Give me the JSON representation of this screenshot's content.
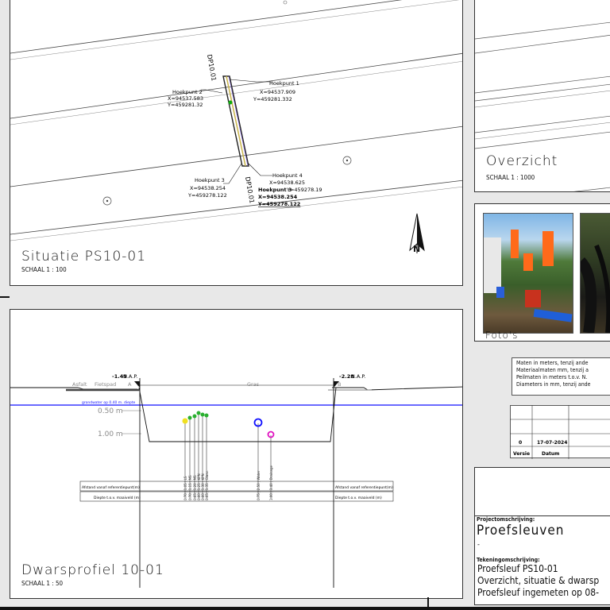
{
  "situatie": {
    "title": "Situatie PS10-01",
    "scale": "SCHAAL 1 : 100",
    "dp_top": "DP10.01",
    "dp_bottom": "DP10.01",
    "hoekpunt1": {
      "label": "Hoekpunt 1",
      "x": "X=94537.909",
      "y": "Y=459281.332"
    },
    "hoekpunt2": {
      "label": "Hoekpunt 2",
      "x": "X=94537.583",
      "y": "Y=459281.32"
    },
    "hoekpunt3": {
      "label": "Hoekpunt 3",
      "x": "X=94538.254",
      "y": "Y=459278.122"
    },
    "hoekpunt4": {
      "label": "Hoekpunt 4",
      "x": "X=94538.625",
      "y": "Y=459278.19"
    },
    "overlap": {
      "label": "Hoekpunt 3",
      "x": "X=94538.254",
      "y": "Y=459278.122"
    }
  },
  "overzicht": {
    "title": "Overzicht",
    "scale": "SCHAAL 1 : 1000"
  },
  "fotos": {
    "title": "Foto's"
  },
  "notes": [
    "Maten in meters, tenzij ande",
    "Materiaalmaten mm, tenzij a",
    "Peilmaten in meters t.o.v. N.",
    "Diameters in mm, tenzij ande"
  ],
  "revisions": {
    "row": {
      "versie": "0",
      "datum": "17-07-2024"
    },
    "headers": {
      "versie": "Versie",
      "datum": "Datum"
    }
  },
  "dwarsprofiel": {
    "title": "Dwarsprofiel 10-01",
    "scale": "SCHAAL 1 : 50",
    "level_a": "-1.49",
    "level_b": "-2.28",
    "nap": "N.A.P.",
    "asfalt": "Asfalt",
    "fietspad": "Fietspad",
    "point_a": "A",
    "point_b": "B",
    "gras": "Gras",
    "grondwater": "grondwater op 0.40 m. diepte",
    "depth1": "0.50 m",
    "depth2": "1.00 m",
    "row_afstand": "Afstand vanaf referentiepunt(m)",
    "row_diepte": "Diepte t.o.v. maaiveld (m)",
    "cables": [
      "0.70 | 1.05 | LS",
      "0.70 | 1.15 | MS",
      "0.65 | 1.20 | MS",
      "0.60 | 1.25 | KPN",
      "0.60 | 1.30 | KPN",
      "0.65 | 1.35 | Glasv."
    ],
    "pipe1": "0.75 | 2.50 | Water",
    "pipe2": "1.00 | 3.40 | Drainage"
  },
  "titleblock": {
    "proj_label": "Projectomschrijving:",
    "project": "Proefsleuven",
    "dash": "-",
    "tek_label": "Tekeningomschrijving:",
    "line1": "Proefsleuf PS10-01",
    "line2": "Overzicht, situatie & dwarsp",
    "line3": "Proefsleuf ingemeten op 08-"
  },
  "colors": {
    "groundwater": "#1010ff",
    "border": "#333333"
  }
}
